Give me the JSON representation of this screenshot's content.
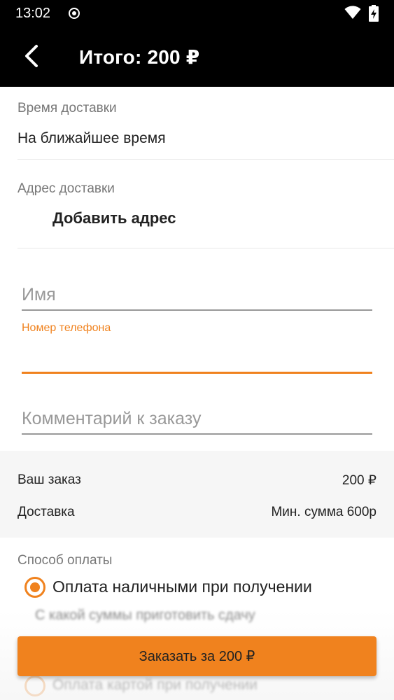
{
  "status_bar": {
    "time": "13:02"
  },
  "app_bar": {
    "title": "Итого: 200 ₽"
  },
  "delivery_time": {
    "label": "Время доставки",
    "value": "На ближайшее время"
  },
  "delivery_address": {
    "label": "Адрес доставки",
    "add_label": "Добавить адрес"
  },
  "form": {
    "name_placeholder": "Имя",
    "phone_label": "Номер телефона",
    "phone_value": "",
    "comment_placeholder": "Комментарий к заказу"
  },
  "summary": {
    "order_label": "Ваш заказ",
    "order_value": "200 ₽",
    "delivery_label": "Доставка",
    "delivery_value": "Мин. сумма 600р"
  },
  "payment": {
    "label": "Способ оплаты",
    "options": [
      {
        "label": "Оплата наличными при получении",
        "checked": true
      },
      {
        "label": "Оплата картой при получении",
        "checked": false
      }
    ],
    "change_hint": "С какой суммы приготовить сдачу"
  },
  "order_button": {
    "label": "Заказать за 200 ₽"
  },
  "colors": {
    "accent": "#f0821e",
    "appbar": "#000000"
  }
}
